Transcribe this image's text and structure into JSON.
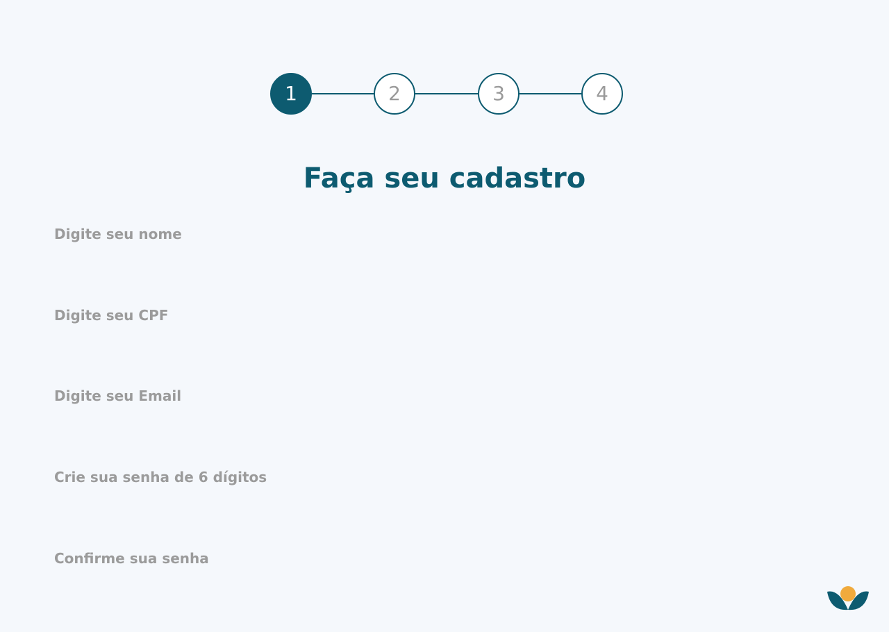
{
  "stepper": {
    "steps": [
      "1",
      "2",
      "3",
      "4"
    ],
    "active_step": 1
  },
  "page": {
    "title": "Faça seu cadastro"
  },
  "form": {
    "name_placeholder": "Digite seu nome",
    "cpf_placeholder": "Digite seu CPF",
    "email_placeholder": "Digite seu Email",
    "password_placeholder": "Crie sua senha de 6 dígitos",
    "confirm_password_placeholder": "Confirme sua senha"
  },
  "colors": {
    "primary": "#0d5b70",
    "accent": "#f0aa3c",
    "background": "#f5f8fc",
    "placeholder": "#9b9b9b"
  },
  "icons": {
    "logo": "sprout-logo-icon"
  }
}
